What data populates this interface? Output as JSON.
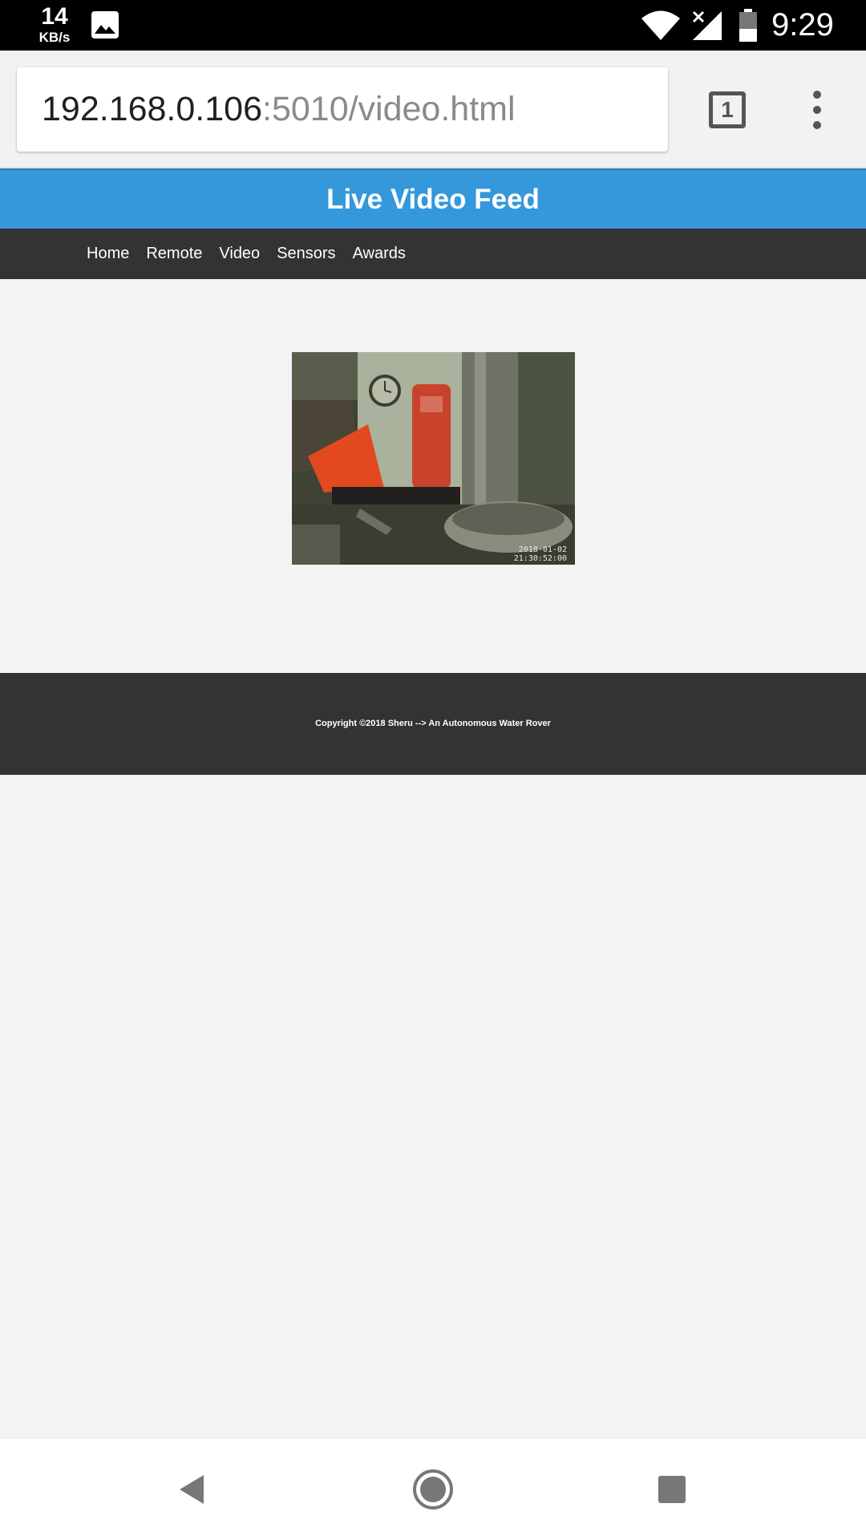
{
  "status_bar": {
    "net_speed_value": "14",
    "net_speed_unit": "KB/s",
    "time": "9:29",
    "icons": [
      "image-notification-icon",
      "wifi-icon",
      "cell-signal-icon",
      "battery-icon"
    ]
  },
  "browser": {
    "url_host": "192.168.0.106",
    "url_path": ":5010/video.html",
    "tab_count": "1"
  },
  "page": {
    "title": "Live Video Feed",
    "nav": [
      "Home",
      "Remote",
      "Video",
      "Sensors",
      "Awards"
    ],
    "video": {
      "timestamp_date": "2018-01-02",
      "timestamp_time": "21:30:52:00"
    },
    "footer": "Copyright ©2018 Sheru --> An Autonomous Water Rover"
  },
  "system_nav": {
    "icons": [
      "back-icon",
      "home-icon",
      "recents-icon"
    ]
  },
  "colors": {
    "header": "#3498db",
    "nav_background": "#333333",
    "page_background": "#f3f3f3"
  }
}
